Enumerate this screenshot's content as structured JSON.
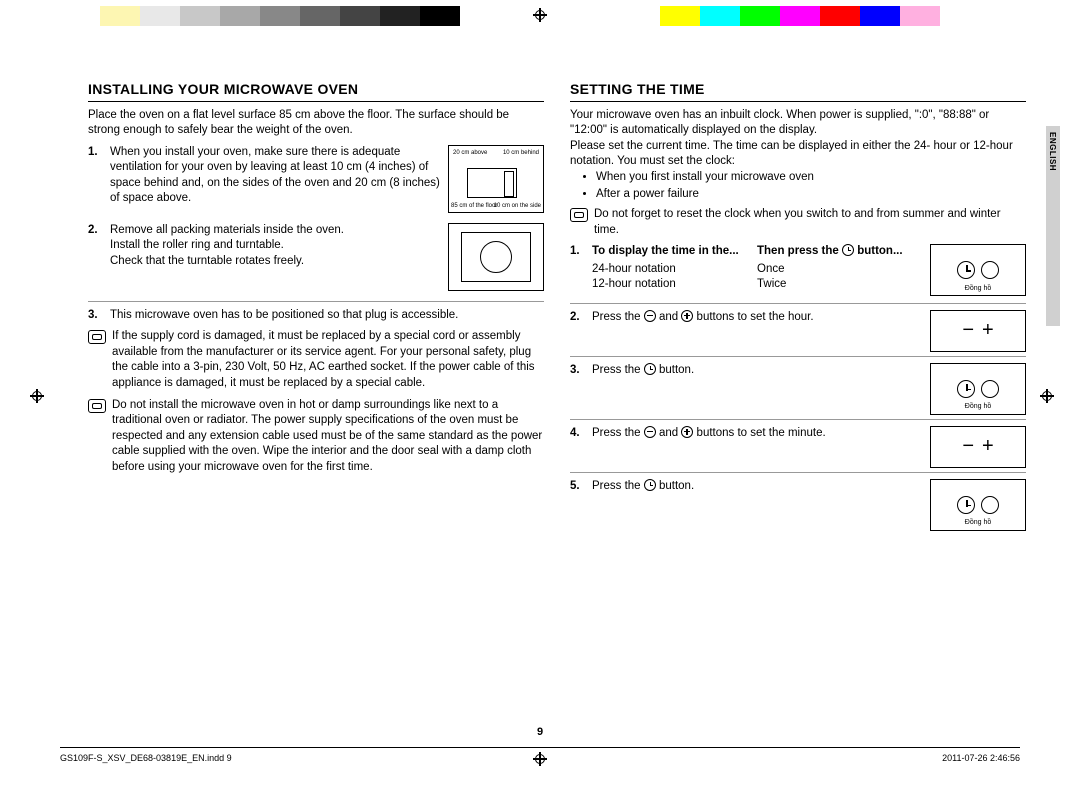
{
  "colorBar": [
    "#fff",
    "#fdf6b2",
    "#e8e8e8",
    "#c8c8c8",
    "#a8a8a8",
    "#888",
    "#666",
    "#444",
    "#222",
    "#000",
    "#fff",
    "#fff",
    "#fff",
    "#fff",
    "#fff",
    "#ffff00",
    "#00ffff",
    "#00ff00",
    "#ff00ff",
    "#ff0000",
    "#0000ff",
    "#ffb0e0",
    "#fff",
    "#fff"
  ],
  "sideTab": "ENGLISH",
  "pageNumber": "9",
  "footerLeft": "GS109F-S_XSV_DE68-03819E_EN.indd   9",
  "footerRight": "2011-07-26   2:46:56",
  "left": {
    "heading": "INSTALLING YOUR MICROWAVE OVEN",
    "intro": "Place the oven on a flat level surface 85 cm above the floor. The surface should be strong enough to safely bear the weight of the oven.",
    "step1": "When you install your oven, make sure there is adequate ventilation for your oven by leaving at least 10 cm (4 inches) of space behind and, on the sides of the oven and 20 cm (8 inches) of space above.",
    "fig1Labels": {
      "a": "20 cm above",
      "b": "10 cm behind",
      "c": "85 cm of the floor",
      "d": "10 cm on the side"
    },
    "step2a": "Remove all packing materials inside the oven.",
    "step2b": "Install the roller ring and turntable.",
    "step2c": "Check that the turntable rotates freely.",
    "step3": "This microwave oven has to be positioned so that plug is accessible.",
    "note1": "If the supply cord is damaged, it must be replaced by a special cord or assembly available from the manufacturer or its service agent. For your personal safety, plug the cable into a 3-pin, 230 Volt, 50 Hz, AC earthed socket. If the power cable of this appliance is damaged, it must be replaced by a special cable.",
    "note2": "Do not install the microwave oven in hot or damp surroundings like next to a traditional oven or radiator. The power supply specifications of the oven must be respected and any extension cable used must be of the same standard as the power cable supplied with the oven. Wipe the interior and the door seal with a damp cloth before using your microwave oven for the first time."
  },
  "right": {
    "heading": "SETTING THE TIME",
    "intro1": "Your microwave oven has an inbuilt clock. When power is supplied, \":0\", \"88:88\" or \"12:00\" is automatically displayed on the display.",
    "intro2": "Please set the current time. The time can be displayed in either the 24- hour or 12-hour notation. You must set the clock:",
    "bullet1": "When you first install your microwave oven",
    "bullet2": "After a power failure",
    "note": "Do not forget to reset the clock when you switch to and from summer and winter time.",
    "tbl": {
      "h1": "To display the time in the...",
      "h2": "Then press the ",
      "h2suffix": " button...",
      "r1c1": "24-hour notation",
      "r1c2": "Once",
      "r2c1": "12-hour notation",
      "r2c2": "Twice"
    },
    "clockLabel": "Đồng hồ",
    "step2": "Press the ",
    "step2mid": " and ",
    "step2end": " buttons to set the hour.",
    "step3": "Press the ",
    "step3end": " button.",
    "step4": "Press the ",
    "step4mid": " and ",
    "step4end": " buttons to set the minute.",
    "step5": "Press the ",
    "step5end": " button."
  },
  "nums": {
    "n1": "1.",
    "n2": "2.",
    "n3": "3.",
    "n4": "4.",
    "n5": "5."
  }
}
